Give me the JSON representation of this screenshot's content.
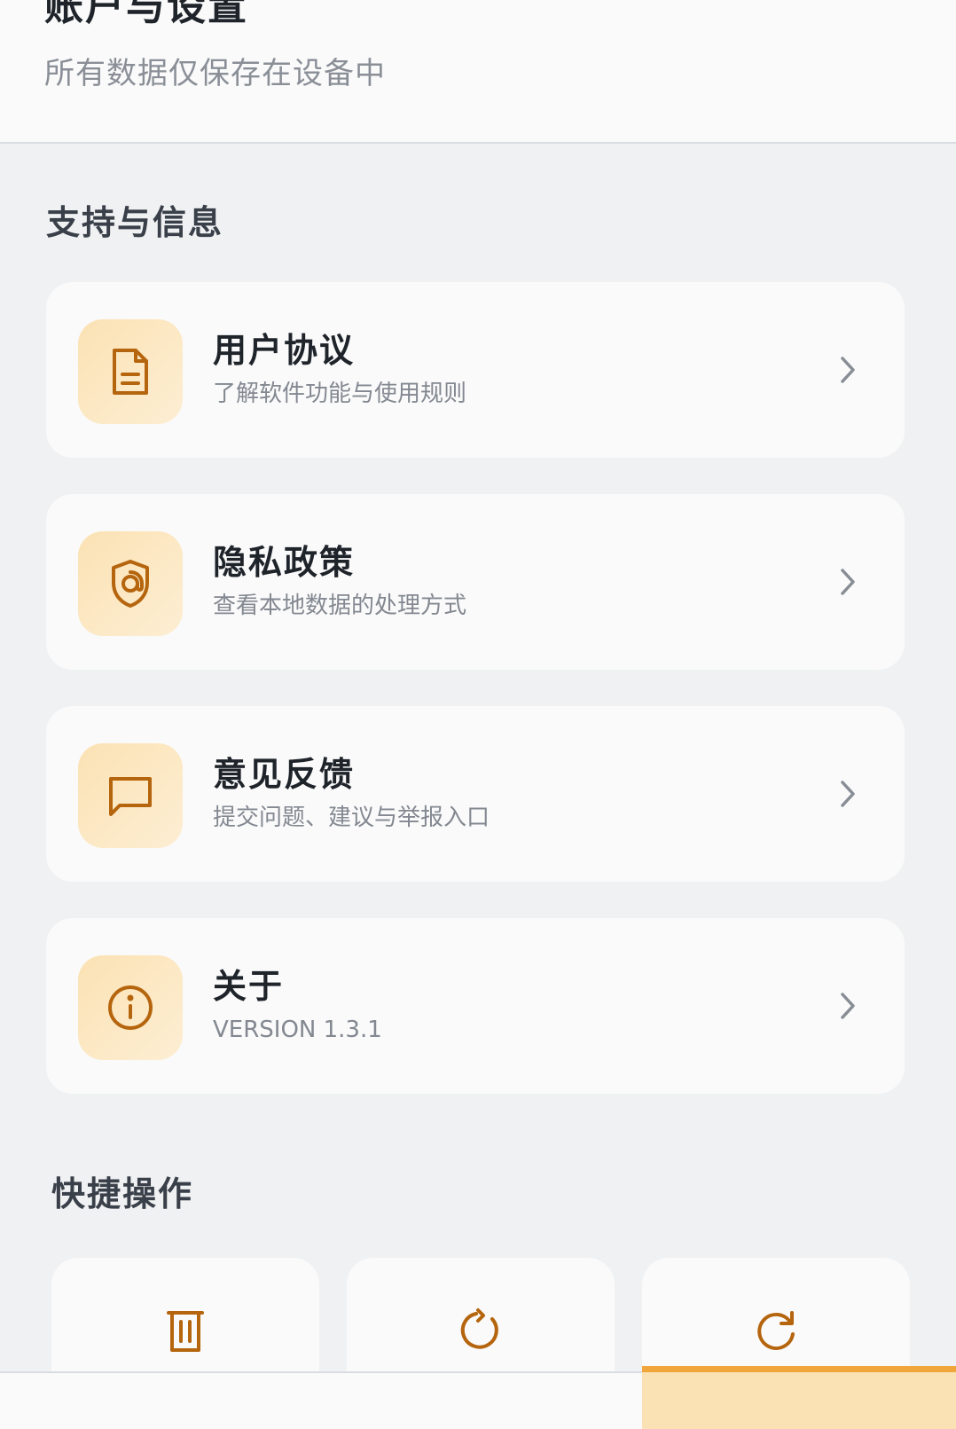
{
  "header": {
    "title": "账户与设置",
    "subtitle": "所有数据仅保存在设备中"
  },
  "support": {
    "title": "支持与信息",
    "items": [
      {
        "title": "用户协议",
        "subtitle": "了解软件功能与使用规则",
        "icon": "document-icon"
      },
      {
        "title": "隐私政策",
        "subtitle": "查看本地数据的处理方式",
        "icon": "privacy-shield-icon"
      },
      {
        "title": "意见反馈",
        "subtitle": "提交问题、建议与举报入口",
        "icon": "message-icon"
      },
      {
        "title": "关于",
        "subtitle": "VERSION 1.3.1",
        "icon": "info-icon"
      }
    ]
  },
  "quick_actions": {
    "title": "快捷操作",
    "items": [
      {
        "icon": "trash-icon"
      },
      {
        "icon": "reset-icon"
      },
      {
        "icon": "refresh-icon"
      }
    ]
  },
  "colors": {
    "accent": "#b5650d",
    "icon_bg": "#fbe2b4",
    "tab_accent": "#f0a63a",
    "page_bg": "#f0f1f3",
    "card_bg": "#fafafa"
  }
}
